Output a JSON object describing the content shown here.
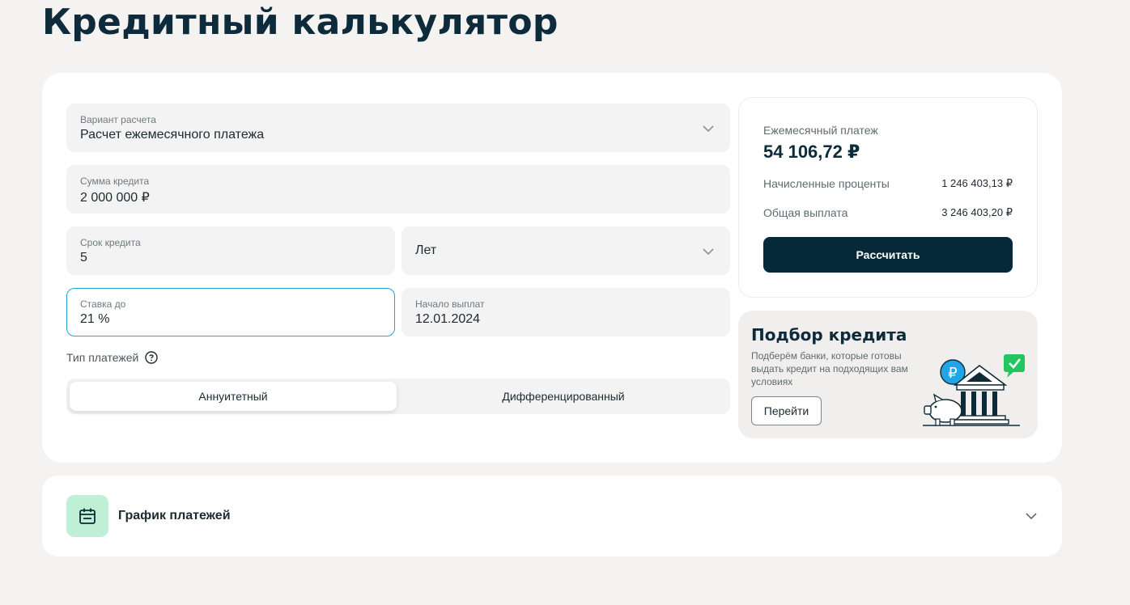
{
  "page": {
    "title": "Кредитный калькулятор"
  },
  "form": {
    "calc_variant": {
      "label": "Вариант расчета",
      "value": "Расчет ежемесячного платежа"
    },
    "amount": {
      "label": "Сумма кредита",
      "value": "2 000 000 ₽"
    },
    "term": {
      "label": "Срок кредита",
      "value": "5"
    },
    "term_unit": {
      "value": "Лет"
    },
    "rate": {
      "label": "Ставка до",
      "value": "21 %"
    },
    "start": {
      "label": "Начало выплат",
      "value": "12.01.2024"
    },
    "payment_type_label": "Тип платежей",
    "payment_types": [
      "Аннуитетный",
      "Дифференцированный"
    ],
    "selected_payment_type": "Аннуитетный"
  },
  "result": {
    "monthly_label": "Ежемесячный платеж",
    "monthly_value": "54 106,72 ₽",
    "interest_label": "Начисленные проценты",
    "interest_value": "1 246 403,13 ₽",
    "total_label": "Общая выплата",
    "total_value": "3 246 403,20 ₽",
    "calc_button": "Рассчитать"
  },
  "promo": {
    "title": "Подбор кредита",
    "text": "Подберём банки, которые готовы выдать кредит на подходящих вам условиях",
    "button": "Перейти"
  },
  "schedule": {
    "title": "График платежей"
  },
  "colors": {
    "accent": "#06293a",
    "active_border": "#1ea6d8",
    "green": "#bff0d6",
    "check_green": "#22c55e",
    "coin_blue": "#1ea6e8"
  }
}
